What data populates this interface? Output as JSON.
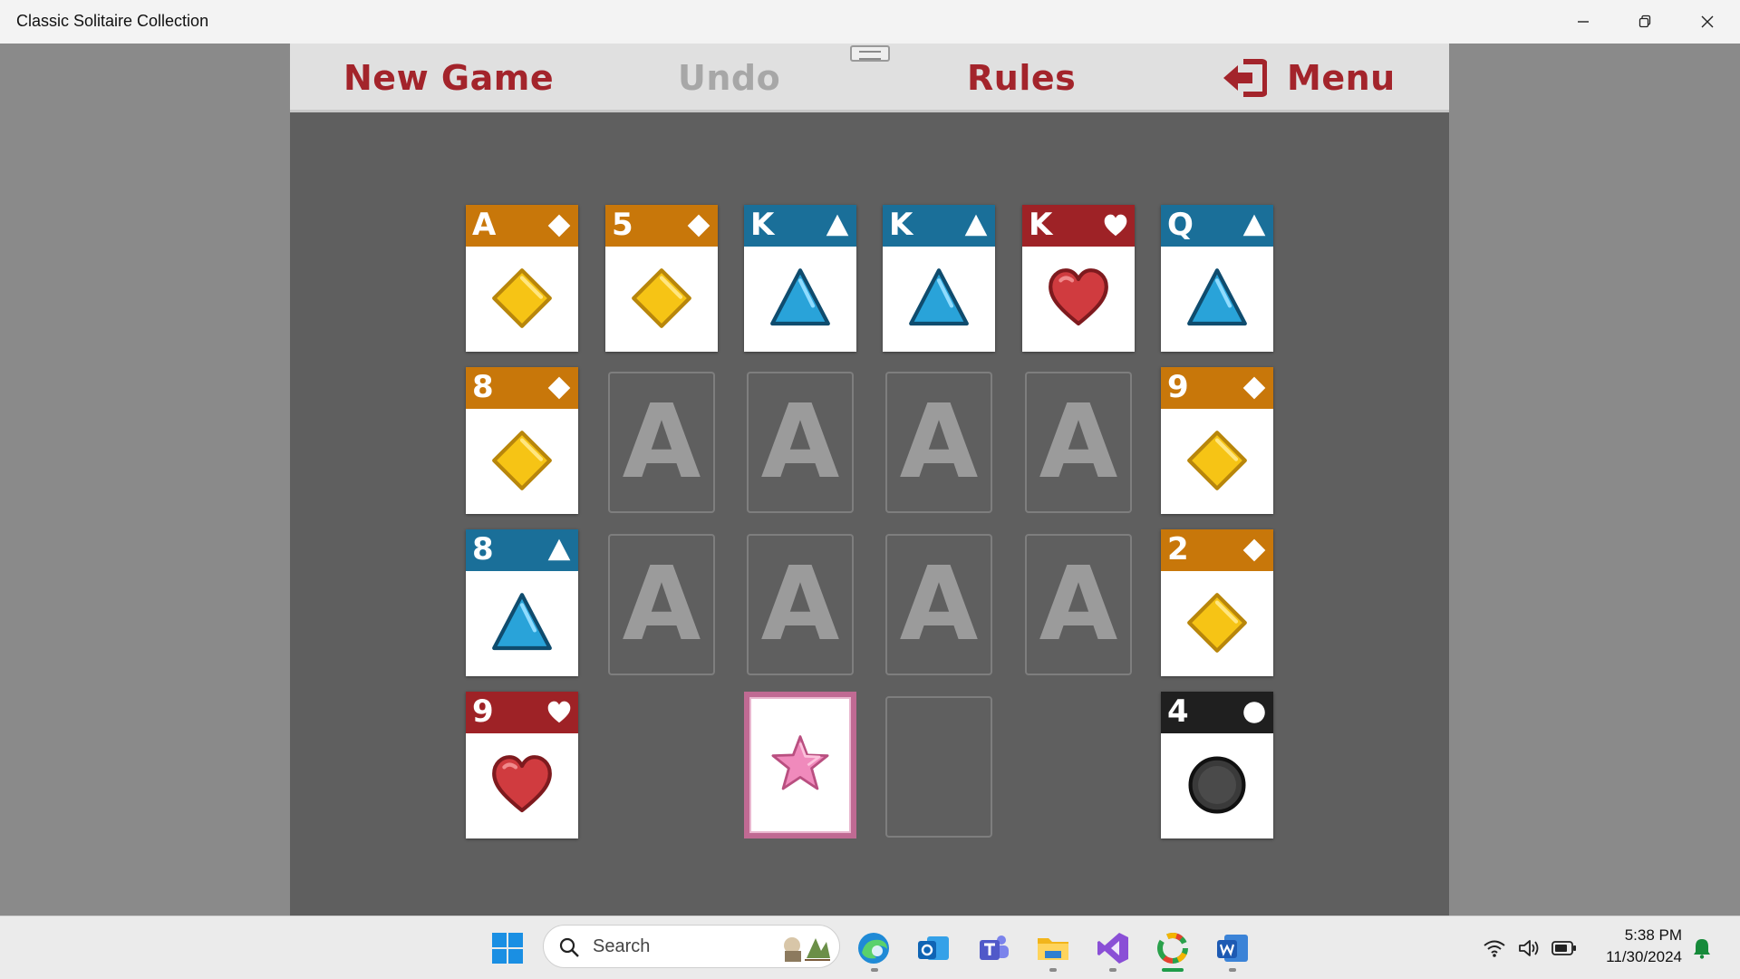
{
  "window": {
    "title": "Classic Solitaire Collection",
    "controls": [
      "minimize-icon",
      "restore-icon",
      "close-icon"
    ]
  },
  "menu": {
    "new_game": "New Game",
    "undo": "Undo",
    "rules": "Rules",
    "menu": "Menu",
    "undo_disabled": true
  },
  "colors": {
    "diamond_header": "#c8770a",
    "spade_header": "#1a6f99",
    "heart_header": "#9e2226",
    "club_header": "#1f1f1f",
    "diamond_pip": "#f6c415",
    "spade_pip": "#29a3d9",
    "heart_pip": "#d03b3f",
    "club_pip": "#3a3a3a",
    "star_pip": "#f08abc",
    "menu_text": "#a3242b"
  },
  "board": {
    "cards": [
      {
        "rank": "A",
        "suit": "diamond"
      },
      {
        "rank": "5",
        "suit": "diamond"
      },
      {
        "rank": "K",
        "suit": "spade"
      },
      {
        "rank": "K",
        "suit": "spade"
      },
      {
        "rank": "K",
        "suit": "heart"
      },
      {
        "rank": "Q",
        "suit": "spade"
      },
      {
        "rank": "8",
        "suit": "diamond"
      },
      {
        "rank": "9",
        "suit": "diamond"
      },
      {
        "rank": "8",
        "suit": "spade"
      },
      {
        "rank": "2",
        "suit": "diamond"
      },
      {
        "rank": "9",
        "suit": "heart"
      },
      {
        "rank": "4",
        "suit": "club"
      }
    ],
    "foundation_placeholder": "A",
    "foundation_count": 8,
    "stock_icon": "star-icon"
  },
  "taskbar": {
    "search_placeholder": "Search",
    "time": "5:38 PM",
    "date": "11/30/2024",
    "apps": [
      "windows-start-icon",
      "edge-icon",
      "outlook-icon",
      "teams-icon",
      "file-explorer-icon",
      "visual-studio-icon",
      "solitaire-app-icon",
      "word-icon"
    ],
    "tray": [
      "wifi-icon",
      "volume-icon",
      "battery-icon",
      "notification-bell-icon"
    ]
  }
}
